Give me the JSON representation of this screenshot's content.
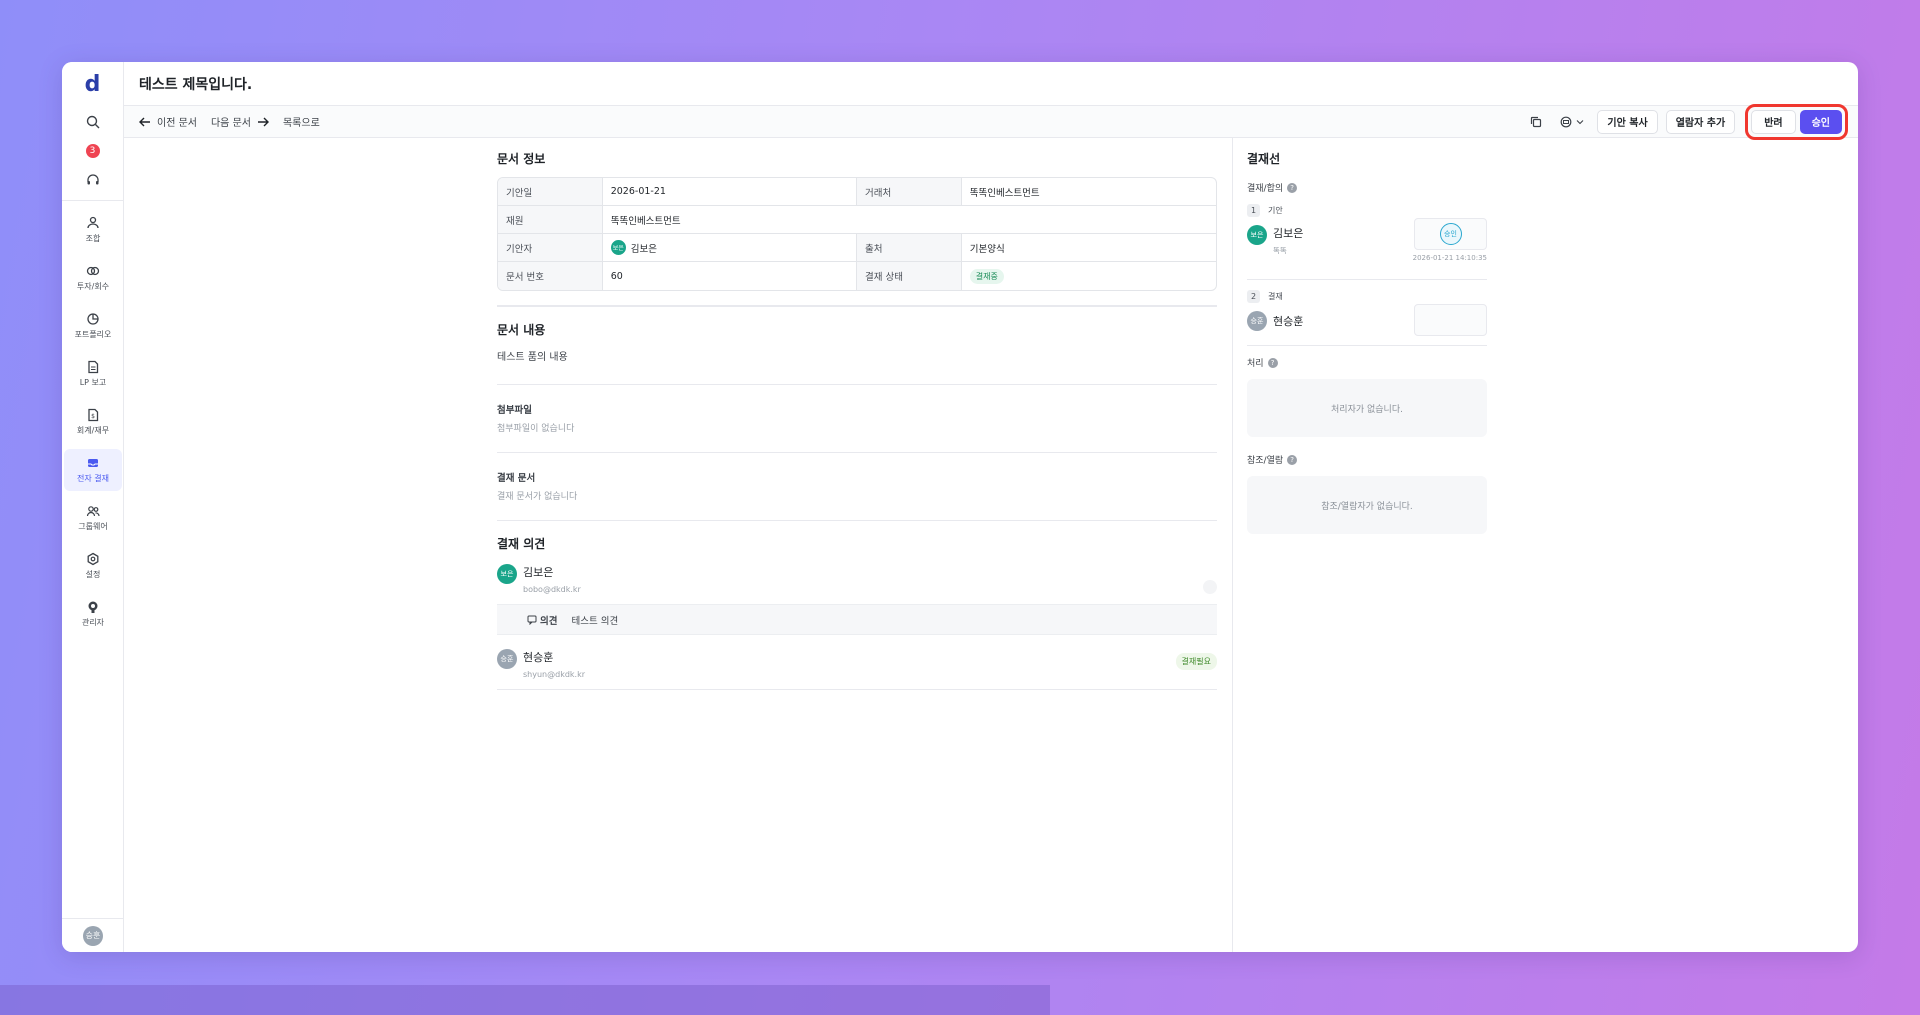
{
  "app": {
    "logo": "d",
    "notification_count": "3"
  },
  "sidebar": {
    "items": [
      {
        "label": "조합",
        "icon": "group-icon"
      },
      {
        "label": "투자/회수",
        "icon": "invest-icon"
      },
      {
        "label": "포트폴리오",
        "icon": "pie-chart-icon"
      },
      {
        "label": "LP 보고",
        "icon": "document-icon"
      },
      {
        "label": "회계/재무",
        "icon": "finance-icon"
      },
      {
        "label": "전자 결재",
        "icon": "inbox-icon"
      },
      {
        "label": "그룹웨어",
        "icon": "people-icon"
      },
      {
        "label": "설정",
        "icon": "gear-icon"
      },
      {
        "label": "관리자",
        "icon": "admin-icon"
      }
    ],
    "user_avatar": "승훈"
  },
  "header": {
    "title": "테스트 제목입니다."
  },
  "toolbar": {
    "prev": "이전 문서",
    "next": "다음 문서",
    "list": "목록으로",
    "copy_draft": "기안 복사",
    "add_viewer": "열람자 추가",
    "reject": "반려",
    "approve": "승인"
  },
  "doc_info": {
    "title": "문서 정보",
    "draft_date_label": "기안일",
    "draft_date": "2026-01-21",
    "client_label": "거래처",
    "client": "똑똑인베스트먼트",
    "source_label": "재원",
    "source": "똑똑인베스트먼트",
    "drafter_label": "기안자",
    "drafter": "김보은",
    "drafter_avatar": "보은",
    "origin_label": "출처",
    "origin": "기본양식",
    "doc_no_label": "문서 번호",
    "doc_no": "60",
    "status_label": "결재 상태",
    "status": "결재중"
  },
  "doc_content": {
    "title": "문서 내용",
    "body": "테스트 품의 내용",
    "attach_title": "첨부파일",
    "attach_empty": "첨부파일이 없습니다",
    "related_title": "결재 문서",
    "related_empty": "결재 문서가 없습니다"
  },
  "opinions": {
    "title": "결재 의견",
    "items": [
      {
        "avatar": "보은",
        "name": "김보은",
        "email": "bobo@dkdk.kr",
        "comment_label": "의견",
        "comment": "테스트 의견"
      },
      {
        "avatar": "승훈",
        "name": "현승훈",
        "email": "shyun@dkdk.kr",
        "badge": "결재필요"
      }
    ]
  },
  "approval_line": {
    "title": "결재선",
    "subtitle": "결재/합의",
    "steps": [
      {
        "num": "1",
        "type": "기안",
        "avatar": "보은",
        "name": "김보은",
        "dept": "똑똑",
        "stamp": "승인",
        "time": "2026-01-21 14:10:35"
      },
      {
        "num": "2",
        "type": "결재",
        "avatar": "승훈",
        "name": "현승훈"
      }
    ],
    "process_title": "처리",
    "process_empty": "처리자가 없습니다.",
    "ref_title": "참조/열람",
    "ref_empty": "참조/열람자가 없습니다."
  },
  "colors": {
    "accent": "#5b4ff0",
    "highlight": "#f0372f",
    "avatar_teal": "#1aa58a",
    "avatar_gray": "#9aa5b1"
  }
}
